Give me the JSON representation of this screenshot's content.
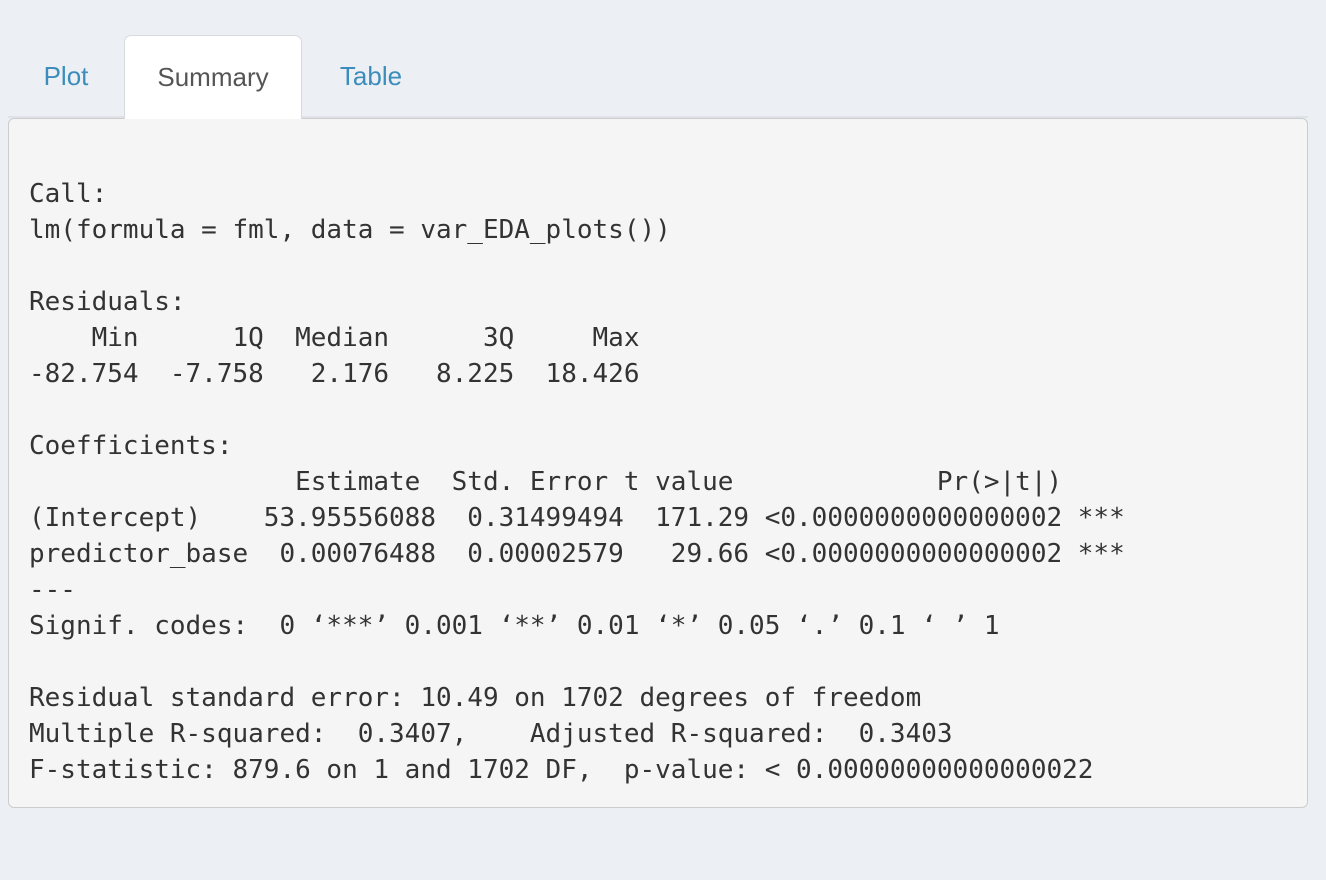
{
  "tabs": {
    "plot": "Plot",
    "summary": "Summary",
    "table": "Table",
    "active": "Summary"
  },
  "summary_output": {
    "lines": [
      "",
      "Call:",
      "lm(formula = fml, data = var_EDA_plots())",
      "",
      "Residuals:",
      "    Min      1Q  Median      3Q     Max ",
      "-82.754  -7.758   2.176   8.225  18.426 ",
      "",
      "Coefficients:",
      "                 Estimate  Std. Error t value             Pr(>|t|)    ",
      "(Intercept)    53.95556088  0.31499494  171.29 <0.0000000000000002 ***",
      "predictor_base  0.00076488  0.00002579   29.66 <0.0000000000000002 ***",
      "---",
      "Signif. codes:  0 ‘***’ 0.001 ‘**’ 0.01 ‘*’ 0.05 ‘.’ 0.1 ‘ ’ 1",
      "",
      "Residual standard error: 10.49 on 1702 degrees of freedom",
      "Multiple R-squared:  0.3407,\tAdjusted R-squared:  0.3403 ",
      "F-statistic: 879.6 on 1 and 1702 DF,  p-value: < 0.00000000000000022"
    ]
  }
}
